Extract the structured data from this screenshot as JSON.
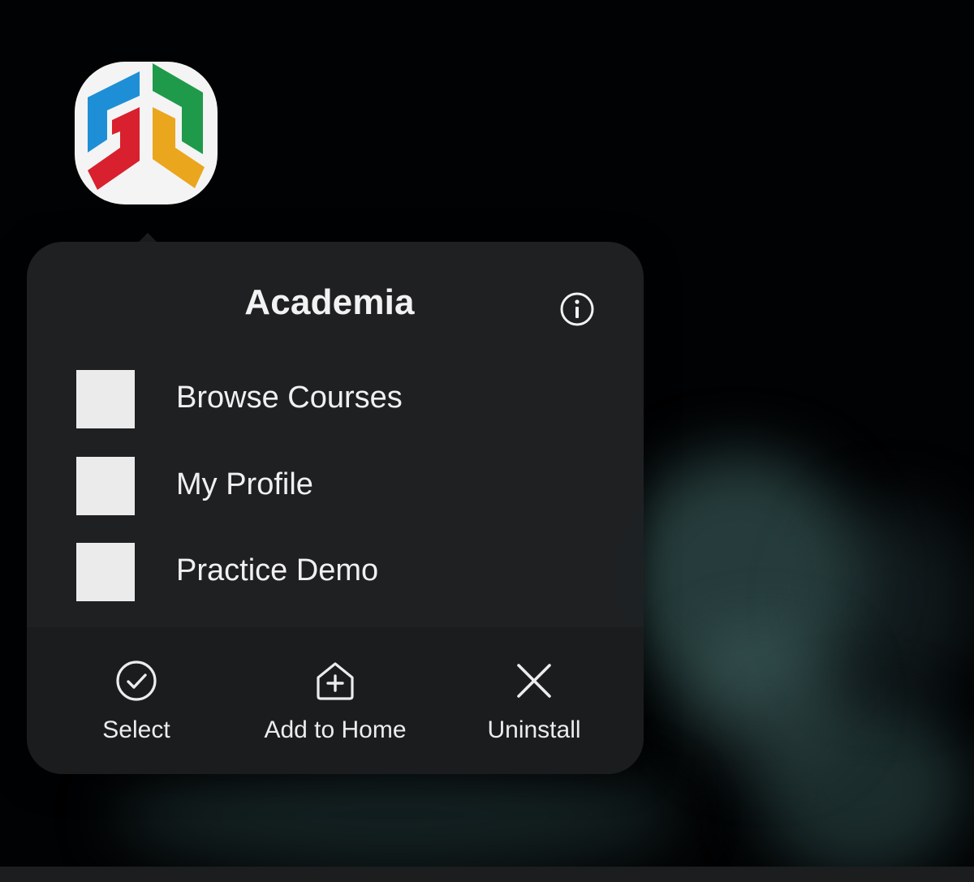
{
  "app": {
    "name": "Academia",
    "icon": "academia-logo-icon"
  },
  "menu": {
    "info_icon": "info-icon",
    "shortcuts": [
      {
        "label": "Browse Courses"
      },
      {
        "label": "My Profile"
      },
      {
        "label": "Practice Demo"
      }
    ],
    "actions": [
      {
        "label": "Select",
        "icon": "check-circle-icon"
      },
      {
        "label": "Add to Home",
        "icon": "add-home-icon"
      },
      {
        "label": "Uninstall",
        "icon": "close-icon"
      }
    ]
  },
  "colors": {
    "menu_bg": "#1f2123",
    "action_bar_bg": "#1a1c1d",
    "logo_blue": "#1e8fd6",
    "logo_green": "#1f9a4a",
    "logo_red": "#d9202e",
    "logo_yellow": "#eaa61c"
  }
}
